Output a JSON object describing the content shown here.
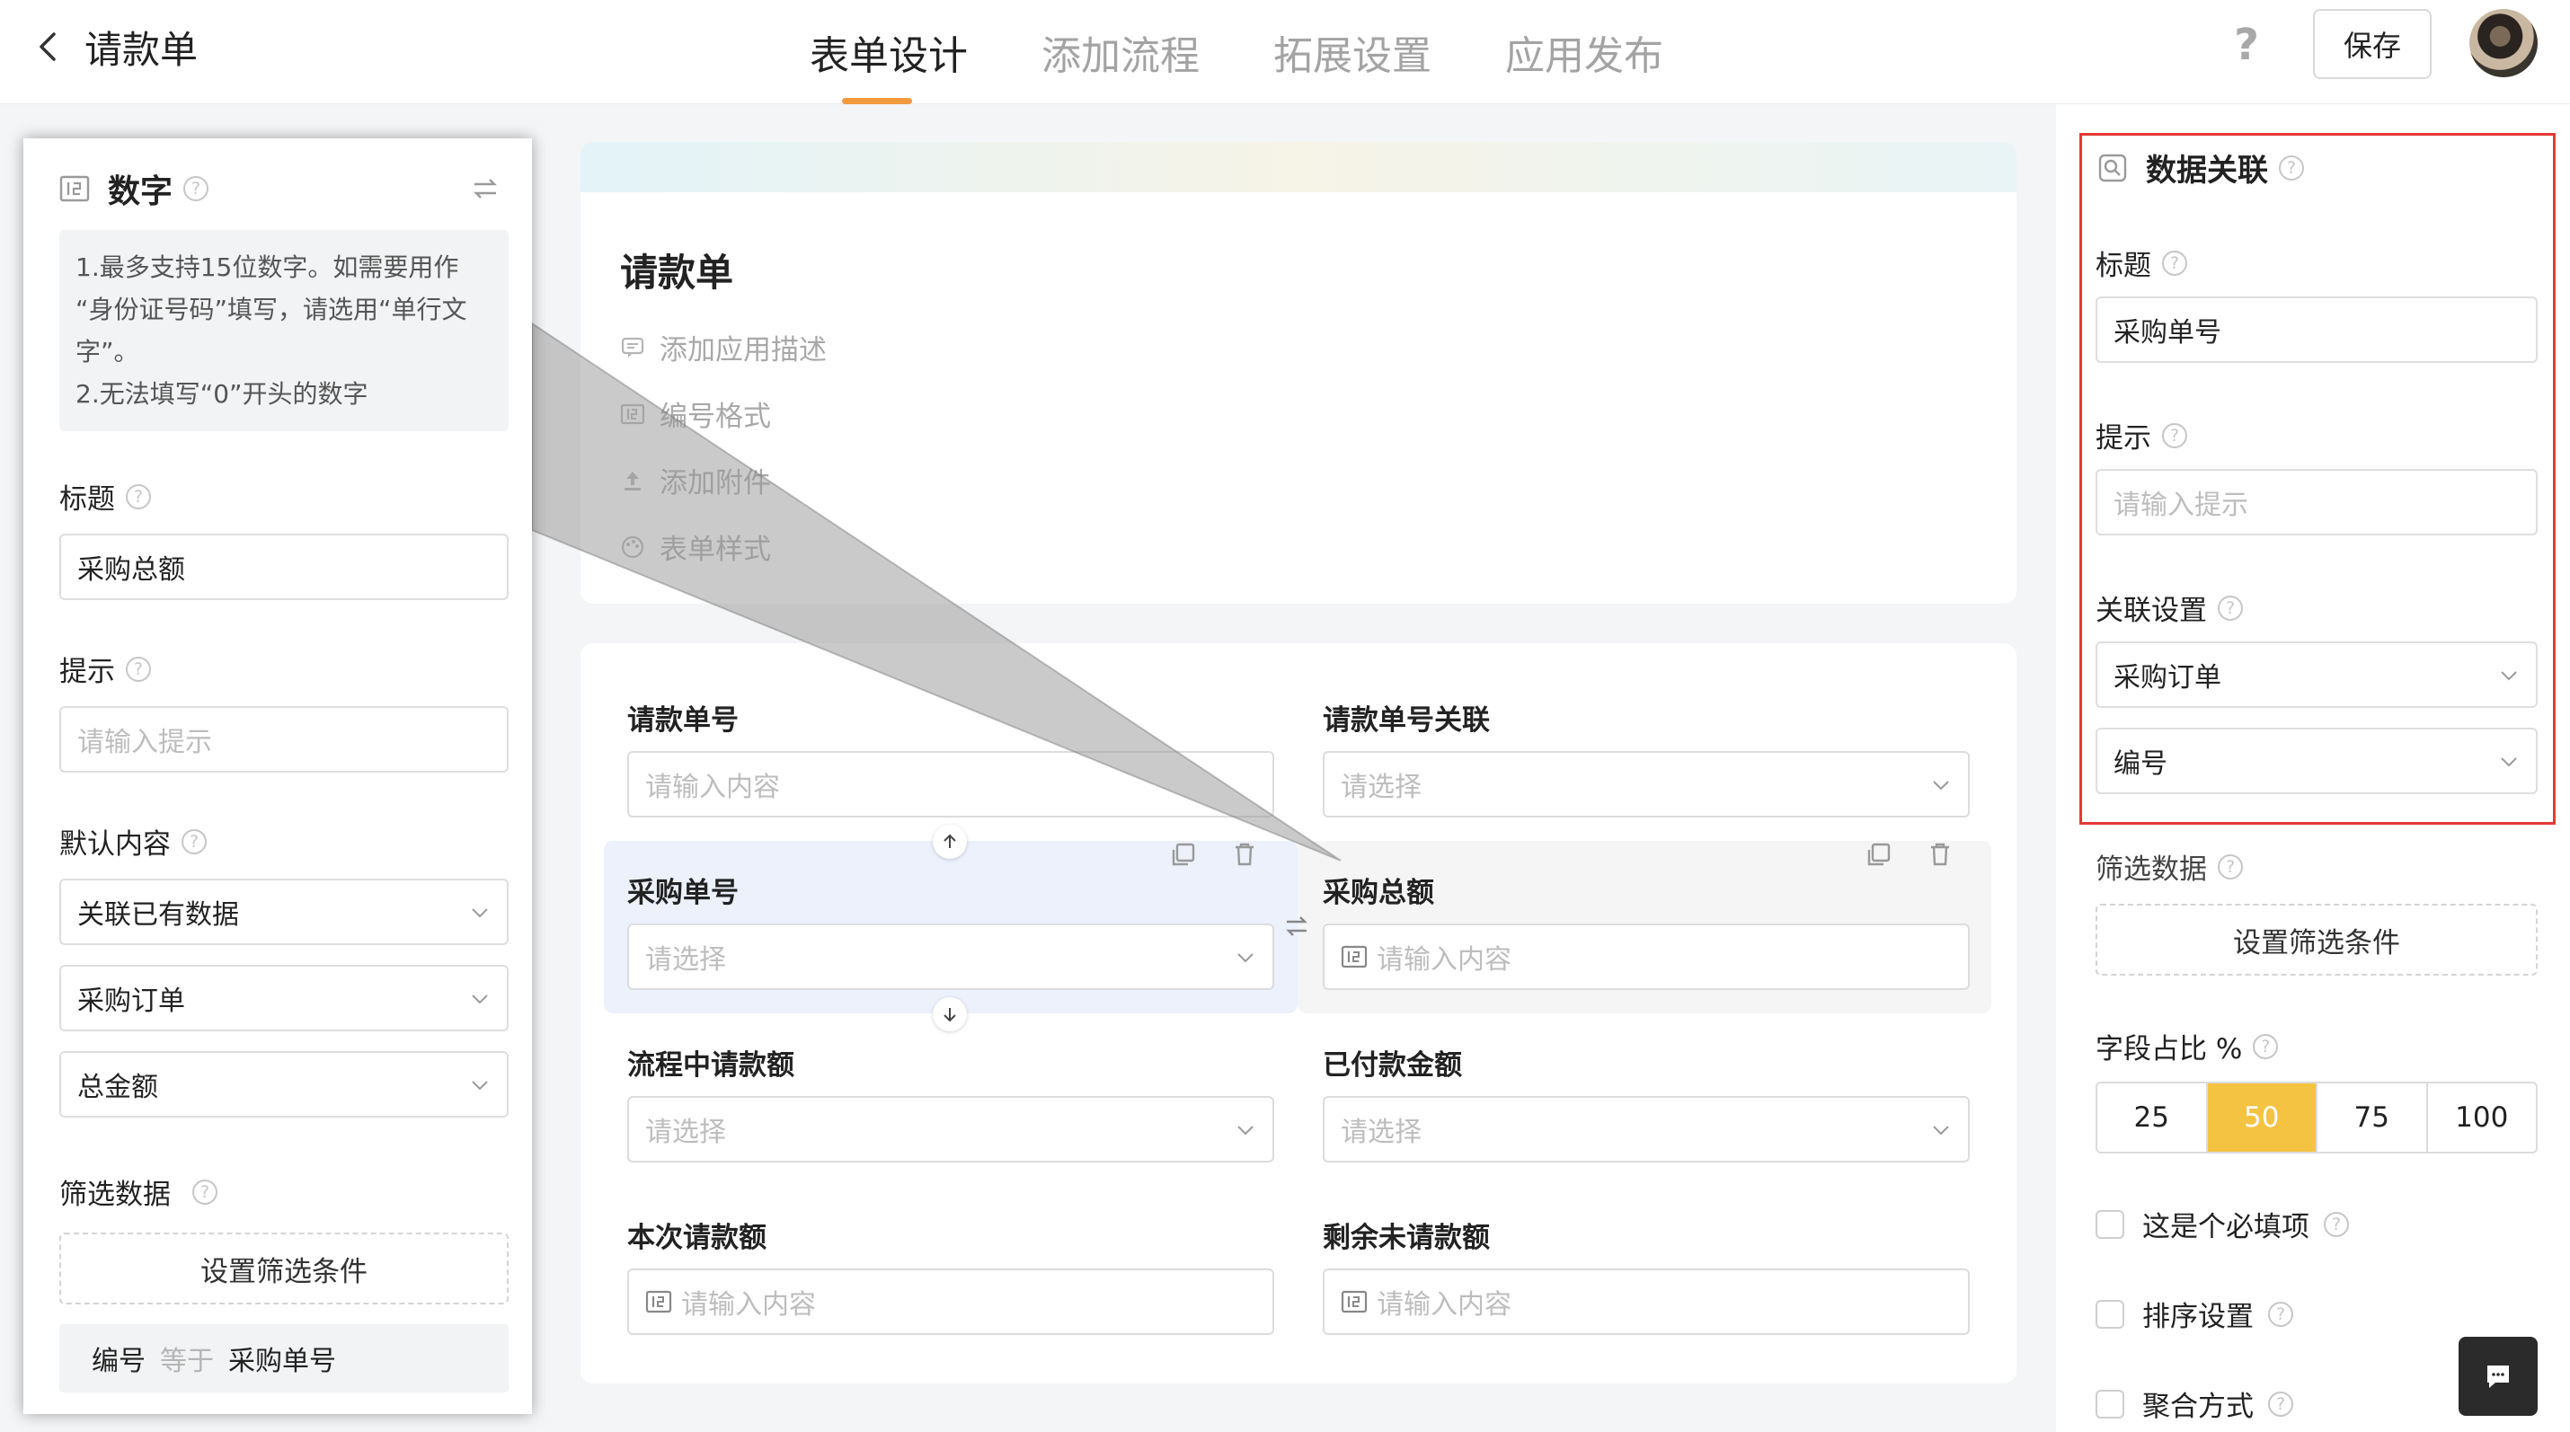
{
  "header": {
    "title": "请款单",
    "tabs": [
      {
        "label": "表单设计",
        "active": true
      },
      {
        "label": "添加流程",
        "active": false
      },
      {
        "label": "拓展设置",
        "active": false
      },
      {
        "label": "应用发布",
        "active": false
      }
    ],
    "help": "?",
    "save_label": "保存"
  },
  "left_panel": {
    "title": "数字",
    "tip_lines": [
      "1.最多支持15位数字。如需要用作",
      "“身份证号码”填写，请选用“单行文",
      "字”。",
      "2.无法填写“0”开头的数字"
    ],
    "title_label": "标题",
    "title_value": "采购总额",
    "hint_label": "提示",
    "hint_placeholder": "请输入提示",
    "default_label": "默认内容",
    "default_select": "关联已有数据",
    "source_select": "采购订单",
    "field_select": "总金额",
    "filter_label": "筛选数据",
    "filter_button": "设置筛选条件",
    "condition": {
      "field": "编号",
      "op": "等于",
      "value": "采购单号"
    }
  },
  "form": {
    "title": "请款单",
    "meta": [
      "添加应用描述",
      "编号格式",
      "添加附件",
      "表单样式"
    ],
    "fields": [
      {
        "label": "请款单号",
        "placeholder": "请输入内容"
      },
      {
        "label": "请款单号关联",
        "placeholder": "请选择"
      },
      {
        "label": "采购单号",
        "placeholder": "请选择"
      },
      {
        "label": "采购总额",
        "placeholder": "请输入内容"
      },
      {
        "label": "流程中请款额",
        "placeholder": "请选择"
      },
      {
        "label": "已付款金额",
        "placeholder": "请选择"
      },
      {
        "label": "本次请款额",
        "placeholder": "请输入内容"
      },
      {
        "label": "剩余未请款额",
        "placeholder": "请输入内容"
      }
    ]
  },
  "right_panel": {
    "title": "数据关联",
    "title_label": "标题",
    "title_value": "采购单号",
    "hint_label": "提示",
    "hint_placeholder": "请输入提示",
    "relation_label": "关联设置",
    "relation_source": "采购订单",
    "relation_field": "编号",
    "filter_label": "筛选数据",
    "filter_button": "设置筛选条件",
    "ratio_label": "字段占比 %",
    "ratios": [
      "25",
      "50",
      "75",
      "100"
    ],
    "ratio_selected": "50",
    "checkboxes": [
      "这是个必填项",
      "排序设置",
      "聚合方式"
    ]
  },
  "colors": {
    "accent": "#f39a40",
    "ratio_selected": "#f5c342",
    "highlight_border": "#e53935"
  }
}
